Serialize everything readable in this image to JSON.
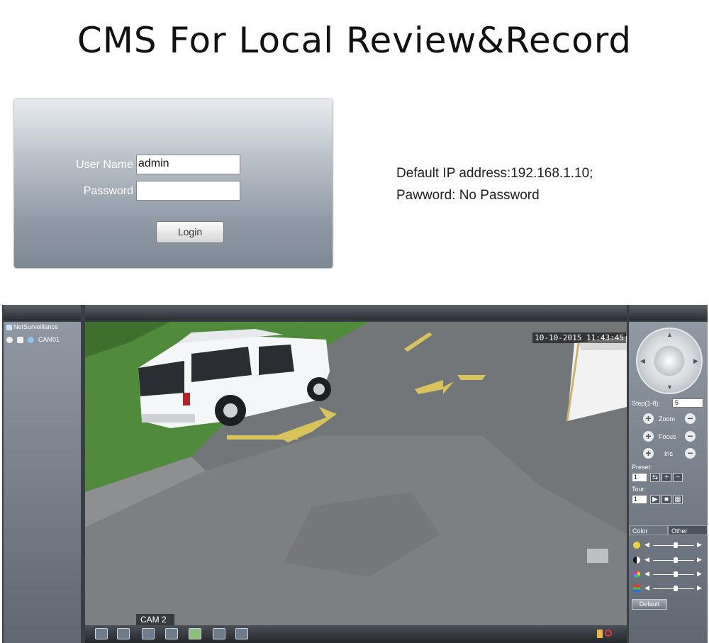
{
  "heading": "CMS For Local Review&Record",
  "login": {
    "username_label": "User Name",
    "username_value": "admin",
    "password_label": "Password",
    "password_value": "",
    "login_button": "Login"
  },
  "notes": {
    "line1": "Default IP address:192.168.1.10;",
    "line2": "Pawword: No Password"
  },
  "cms": {
    "tree_title": "NetSurveillance",
    "camera_item": "CAM01",
    "timestamp": "10-10-2015 11:43:45",
    "cam_label": "CAM 2",
    "step_label": "Step(1-8):",
    "step_value": "5",
    "zoom_label": "Zoom",
    "focus_label": "Focus",
    "iris_label": "Iris",
    "preset_label": "Preset:",
    "preset_value": "1",
    "tour_label": "Tour:",
    "tour_value": "1",
    "tab_color": "Color",
    "tab_other": "Other",
    "default_button": "Default",
    "sliders": [
      {
        "name": "brightness",
        "level": 0.55
      },
      {
        "name": "contrast",
        "level": 0.55
      },
      {
        "name": "saturation",
        "level": 0.55
      },
      {
        "name": "hue",
        "level": 0.55
      }
    ]
  }
}
